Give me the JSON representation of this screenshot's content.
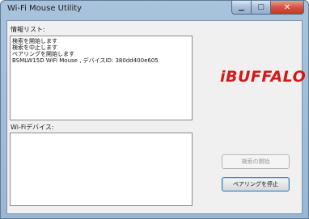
{
  "window": {
    "title": "Wi-Fi Mouse Utility",
    "minimize_glyph": "▁",
    "maximize_glyph": "▢",
    "close_glyph": "✕"
  },
  "info_list": {
    "label": "情報リスト:",
    "lines": [
      "検索を開始します",
      "検索を中止します",
      "ペアリングを開始します",
      "BSMLW15D WiFi Mouse , デバイスID: 380dd400e605"
    ]
  },
  "wifi_devices": {
    "label": "Wi-Fiデバイス:",
    "items": []
  },
  "logo": {
    "text": "iBUFFALO",
    "color": "#d11a1a"
  },
  "buttons": {
    "start_search": "検索の開始",
    "stop_pairing": "ペアリングを停止"
  },
  "colors": {
    "accent": "#d11a1a",
    "close_button": "#c23a24"
  }
}
